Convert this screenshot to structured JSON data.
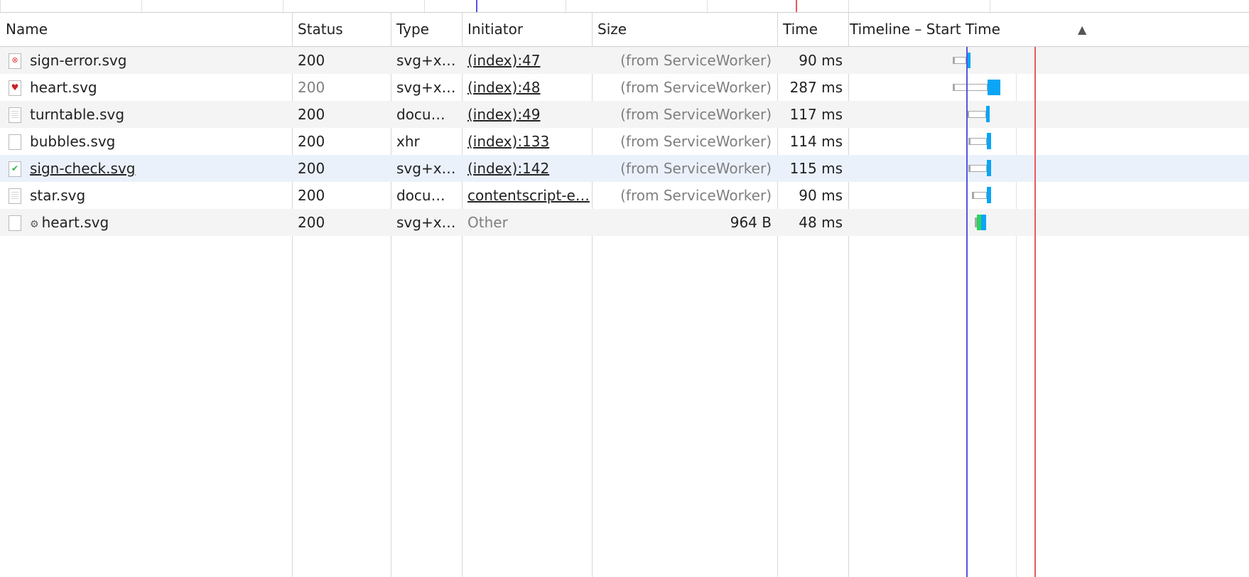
{
  "columns": {
    "name": "Name",
    "status": "Status",
    "type": "Type",
    "initiator": "Initiator",
    "size": "Size",
    "time": "Time",
    "timeline": "Timeline – Start Time",
    "sort_icon": "▲"
  },
  "colors": {
    "dom_content_loaded": "#5555e0",
    "load": "#e85a5a",
    "receiving": "#0ba5f5",
    "highlight_row": "#ebf1fb"
  },
  "rows": [
    {
      "name": "sign-error.svg",
      "icon": "error-image-icon",
      "status": "200",
      "type": "svg+x…",
      "initiator": "(index):47",
      "size": "(from ServiceWorker)",
      "time": "90 ms"
    },
    {
      "name": "heart.svg",
      "icon": "heart-image-icon",
      "status": "200",
      "type": "svg+x…",
      "initiator": "(index):48",
      "size": "(from ServiceWorker)",
      "time": "287 ms"
    },
    {
      "name": "turntable.svg",
      "icon": "document-icon",
      "status": "200",
      "type": "docu…",
      "initiator": "(index):49",
      "size": "(from ServiceWorker)",
      "time": "117 ms"
    },
    {
      "name": "bubbles.svg",
      "icon": "blank-file-icon",
      "status": "200",
      "type": "xhr",
      "initiator": "(index):133",
      "size": "(from ServiceWorker)",
      "time": "114 ms"
    },
    {
      "name": "sign-check.svg",
      "icon": "check-image-icon",
      "status": "200",
      "type": "svg+x…",
      "initiator": "(index):142",
      "size": "(from ServiceWorker)",
      "time": "115 ms"
    },
    {
      "name": "star.svg",
      "icon": "document-icon",
      "status": "200",
      "type": "docu…",
      "initiator": "contentscript-e…",
      "size": "(from ServiceWorker)",
      "time": "90 ms"
    },
    {
      "name": "heart.svg",
      "icon": "blank-file-icon",
      "gear_icon": "gear-icon",
      "status": "200",
      "type": "svg+x…",
      "initiator": "Other",
      "size": "964 B",
      "time": "48 ms"
    }
  ]
}
